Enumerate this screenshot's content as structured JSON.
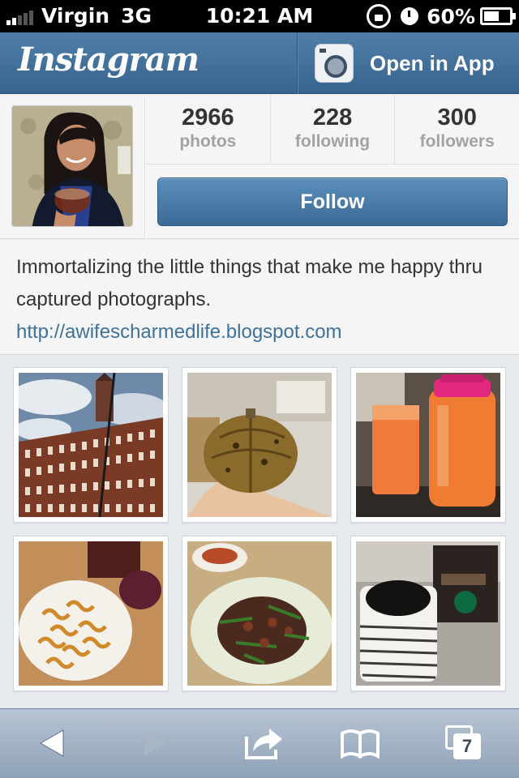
{
  "status": {
    "carrier": "Virgin",
    "network": "3G",
    "time": "10:21 AM",
    "battery": "60%"
  },
  "header": {
    "logo": "Instagram",
    "open_app_label": "Open in App"
  },
  "profile": {
    "stats": [
      {
        "value": "2966",
        "label": "photos"
      },
      {
        "value": "228",
        "label": "following"
      },
      {
        "value": "300",
        "label": "followers"
      }
    ],
    "follow_label": "Follow"
  },
  "bio": {
    "text": "Immortalizing the little things that make me happy thru captured photographs.",
    "link": "http://awifescharmedlife.blogspot.com"
  },
  "photos": [
    {
      "subject": "building"
    },
    {
      "subject": "pumpkin"
    },
    {
      "subject": "juice"
    },
    {
      "subject": "curly-fries"
    },
    {
      "subject": "stir-fry"
    },
    {
      "subject": "coffee"
    }
  ],
  "toolbar": {
    "tabs_count": "7"
  },
  "icons": [
    "back-icon",
    "forward-icon",
    "share-icon",
    "bookmarks-icon",
    "tabs-icon",
    "camera-icon"
  ]
}
